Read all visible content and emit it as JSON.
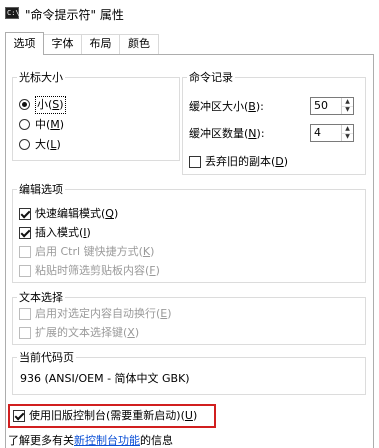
{
  "window": {
    "title": "\"命令提示符\" 属性",
    "icon_label": "C:\\"
  },
  "tabs": [
    {
      "label": "选项",
      "active": true
    },
    {
      "label": "字体",
      "active": false
    },
    {
      "label": "布局",
      "active": false
    },
    {
      "label": "颜色",
      "active": false
    }
  ],
  "cursor_size": {
    "legend": "光标大小",
    "options": [
      {
        "text": "小(",
        "key": "S",
        "close": ")",
        "selected": true
      },
      {
        "text": "中(",
        "key": "M",
        "close": ")",
        "selected": false
      },
      {
        "text": "大(",
        "key": "L",
        "close": ")",
        "selected": false
      }
    ]
  },
  "command_history": {
    "legend": "命令记录",
    "buffer_size_label": "缓冲区大小(",
    "buffer_size_key": "B",
    "buffer_size_close": "):",
    "buffer_size_value": "50",
    "buffer_count_label": "缓冲区数量(",
    "buffer_count_key": "N",
    "buffer_count_close": "):",
    "buffer_count_value": "4",
    "discard_label": "丢弃旧的副本(",
    "discard_key": "D",
    "discard_close": ")",
    "discard_checked": false
  },
  "edit_options": {
    "legend": "编辑选项",
    "items": [
      {
        "text": "快速编辑模式(",
        "key": "Q",
        "close": ")",
        "checked": true,
        "disabled": false
      },
      {
        "text": "插入模式(",
        "key": "I",
        "close": ")",
        "checked": true,
        "disabled": false
      },
      {
        "text": "启用 Ctrl 键快捷方式(",
        "key": "K",
        "close": ")",
        "checked": false,
        "disabled": true
      },
      {
        "text": "粘贴时筛选剪贴板内容(",
        "key": "F",
        "close": ")",
        "checked": false,
        "disabled": true
      }
    ]
  },
  "text_selection": {
    "legend": "文本选择",
    "items": [
      {
        "text": "启用对选定内容自动换行(",
        "key": "E",
        "close": ")",
        "checked": false,
        "disabled": true
      },
      {
        "text": "扩展的文本选择键(",
        "key": "X",
        "close": ")",
        "checked": false,
        "disabled": true
      }
    ]
  },
  "code_page": {
    "legend": "当前代码页",
    "value": "936   (ANSI/OEM - 简体中文 GBK)"
  },
  "legacy": {
    "text": "使用旧版控制台(需要重新启动)(",
    "key": "U",
    "close": ")",
    "checked": true
  },
  "footer": {
    "prefix": "了解更多有关",
    "link": "新控制台功能",
    "suffix": "的信息"
  },
  "colors": {
    "highlight_border": "#d11f1f",
    "link": "#0a4fd6"
  }
}
